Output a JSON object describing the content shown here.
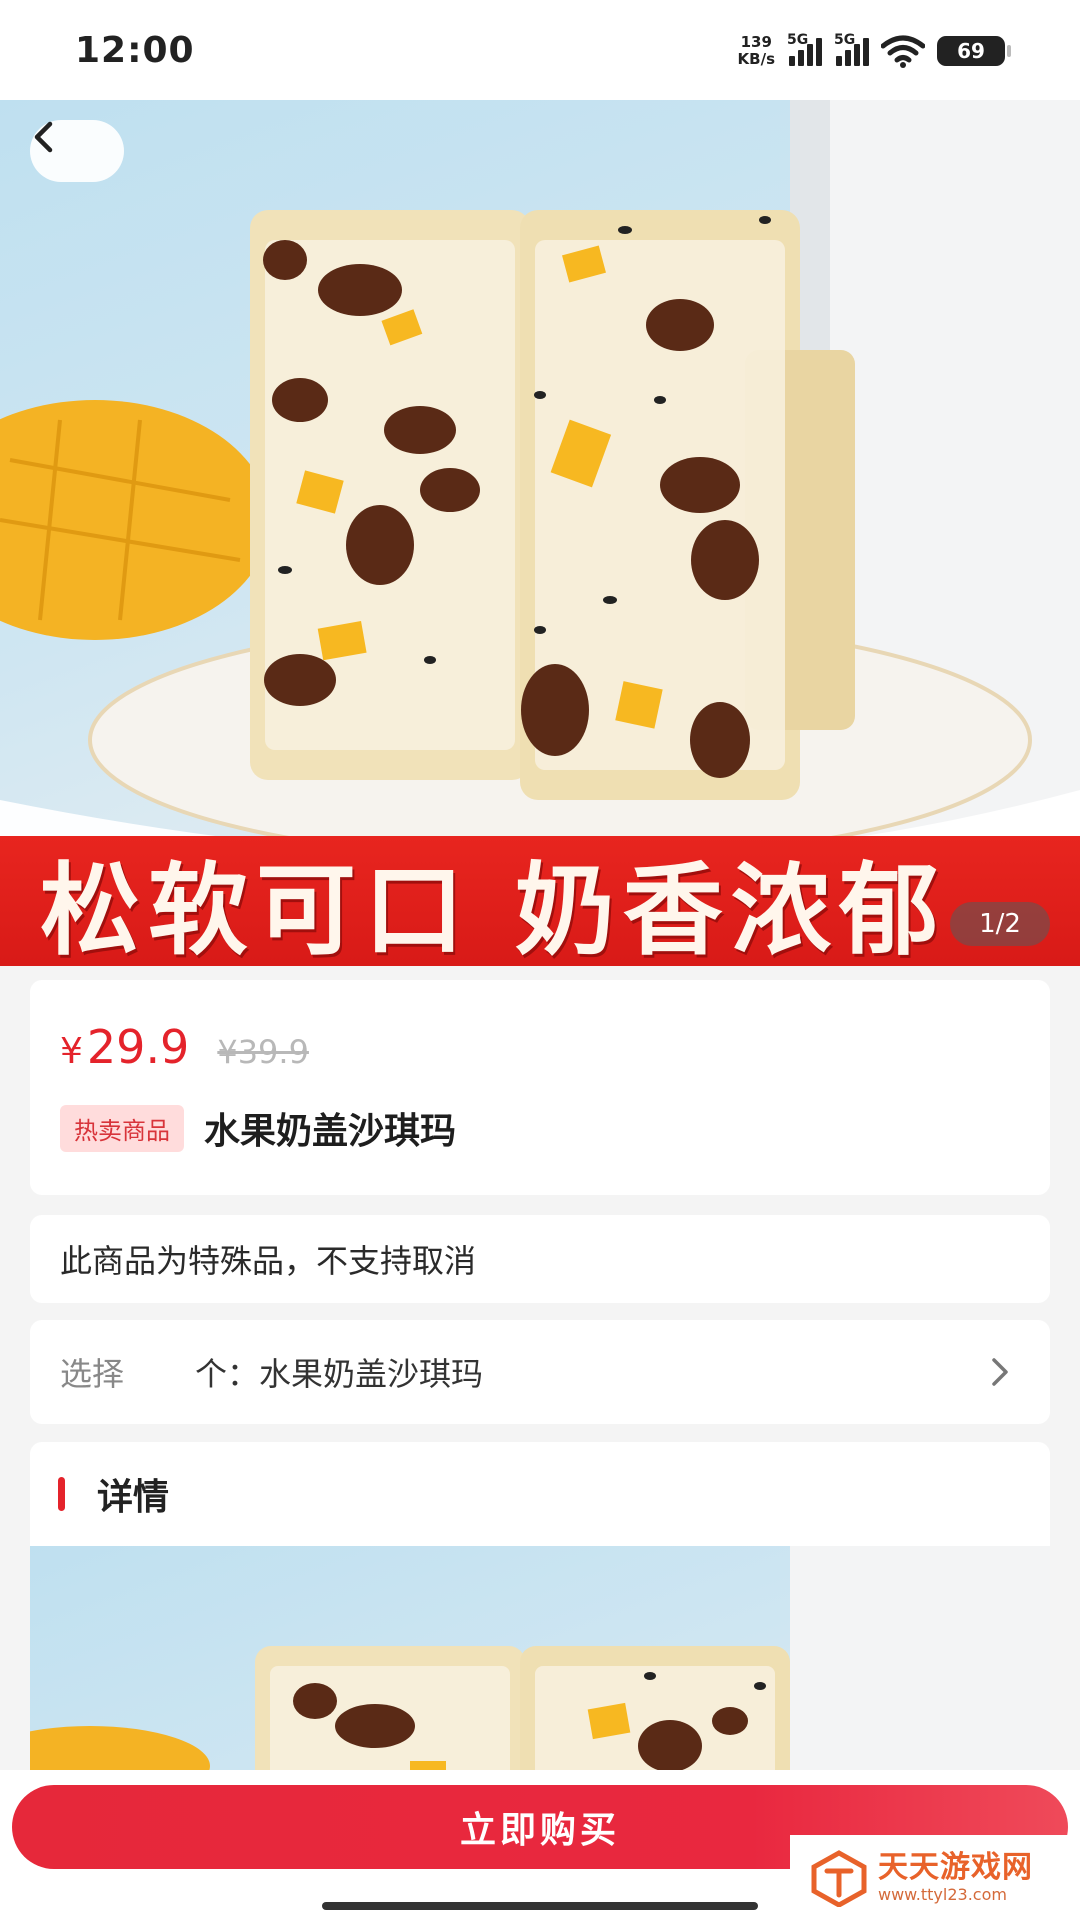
{
  "status_bar": {
    "time": "12:00",
    "net_speed_value": "139",
    "net_speed_unit": "KB/s",
    "sim1": "5G",
    "sim2": "5G",
    "battery": "69"
  },
  "hero": {
    "banner_text": "松软可口 奶香浓郁",
    "pager": "1/2",
    "icons": [
      "back-icon"
    ]
  },
  "product": {
    "price_symbol": "¥",
    "price": "29.9",
    "original_price": "¥39.9",
    "badge": "热卖商品",
    "title": "水果奶盖沙琪玛",
    "notice": "此商品为特殊品，不支持取消",
    "select_label": "选择",
    "select_value": "个：水果奶盖沙琪玛"
  },
  "detail": {
    "title": "详情"
  },
  "bottom": {
    "buy_label": "立即购买"
  },
  "watermark": {
    "title": "天天游戏网",
    "url": "www.ttyl23.com"
  },
  "colors": {
    "accent": "#e4232b",
    "banner_red": "#d81a17",
    "badge_bg": "#ffdcdc"
  }
}
